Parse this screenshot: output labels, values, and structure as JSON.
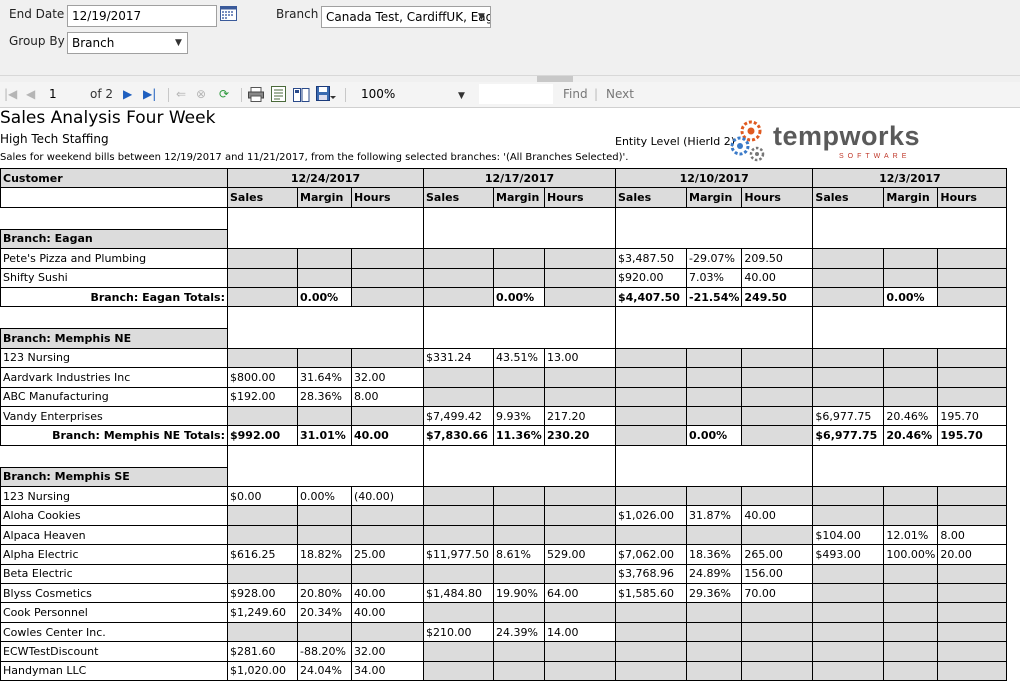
{
  "params": {
    "end_date_label": "End Date",
    "end_date_value": "12/19/2017",
    "branch_label": "Branch",
    "branch_value": "Canada Test, CardiffUK, Eag",
    "group_by_label": "Group By",
    "group_by_value": "Branch"
  },
  "toolbar": {
    "page_current": "1",
    "page_of": "of 2",
    "zoom": "100%",
    "search_value": "",
    "find_label": "Find",
    "sep": "|",
    "next_label": "Next"
  },
  "report": {
    "title": "Sales Analysis Four Week",
    "company": "High Tech Staffing",
    "description": "Sales for weekend bills between 12/19/2017 and 11/21/2017, from the following selected branches: '(All Branches Selected)'.",
    "entity_level": "Entity Level (HierId 2)",
    "logo_text": "tempworks",
    "logo_sub": "SOFTWARE",
    "customer_header": "Customer",
    "week_headers": [
      "12/24/2017",
      "12/17/2017",
      "12/10/2017",
      "12/3/2017"
    ],
    "col_sales": "Sales",
    "col_margin": "Margin",
    "col_hours": "Hours"
  },
  "rows": [
    {
      "type": "gap"
    },
    {
      "type": "branch",
      "label": "Branch: Eagan"
    },
    {
      "type": "data",
      "customer": "Pete's Pizza and Plumbing",
      "weeks": [
        [
          "",
          "",
          ""
        ],
        [
          "",
          "",
          ""
        ],
        [
          "$3,487.50",
          "-29.07%",
          "209.50"
        ],
        [
          "",
          "",
          ""
        ]
      ]
    },
    {
      "type": "data",
      "customer": "Shifty Sushi",
      "weeks": [
        [
          "",
          "",
          ""
        ],
        [
          "",
          "",
          ""
        ],
        [
          "$920.00",
          "7.03%",
          "40.00"
        ],
        [
          "",
          "",
          ""
        ]
      ]
    },
    {
      "type": "total",
      "label": "Branch: Eagan Totals:",
      "weeks": [
        [
          "",
          "0.00%",
          ""
        ],
        [
          "",
          "0.00%",
          ""
        ],
        [
          "$4,407.50",
          "-21.54%",
          "249.50"
        ],
        [
          "",
          "0.00%",
          ""
        ]
      ]
    },
    {
      "type": "gap"
    },
    {
      "type": "branch",
      "label": "Branch: Memphis NE"
    },
    {
      "type": "data",
      "customer": "123 Nursing",
      "weeks": [
        [
          "",
          "",
          ""
        ],
        [
          "$331.24",
          "43.51%",
          "13.00"
        ],
        [
          "",
          "",
          ""
        ],
        [
          "",
          "",
          ""
        ]
      ]
    },
    {
      "type": "data",
      "customer": "Aardvark Industries Inc",
      "weeks": [
        [
          "$800.00",
          "31.64%",
          "32.00"
        ],
        [
          "",
          "",
          ""
        ],
        [
          "",
          "",
          ""
        ],
        [
          "",
          "",
          ""
        ]
      ]
    },
    {
      "type": "data",
      "customer": "ABC Manufacturing",
      "weeks": [
        [
          "$192.00",
          "28.36%",
          "8.00"
        ],
        [
          "",
          "",
          ""
        ],
        [
          "",
          "",
          ""
        ],
        [
          "",
          "",
          ""
        ]
      ]
    },
    {
      "type": "data",
      "customer": "Vandy Enterprises",
      "weeks": [
        [
          "",
          "",
          ""
        ],
        [
          "$7,499.42",
          "9.93%",
          "217.20"
        ],
        [
          "",
          "",
          ""
        ],
        [
          "$6,977.75",
          "20.46%",
          "195.70"
        ]
      ]
    },
    {
      "type": "total",
      "label": "Branch: Memphis NE Totals:",
      "weeks": [
        [
          "$992.00",
          "31.01%",
          "40.00"
        ],
        [
          "$7,830.66",
          "11.36%",
          "230.20"
        ],
        [
          "",
          "0.00%",
          ""
        ],
        [
          "$6,977.75",
          "20.46%",
          "195.70"
        ]
      ]
    },
    {
      "type": "gap"
    },
    {
      "type": "branch",
      "label": "Branch: Memphis SE"
    },
    {
      "type": "data",
      "customer": "123 Nursing",
      "weeks": [
        [
          "$0.00",
          "0.00%",
          "(40.00)"
        ],
        [
          "",
          "",
          ""
        ],
        [
          "",
          "",
          ""
        ],
        [
          "",
          "",
          ""
        ]
      ]
    },
    {
      "type": "data",
      "customer": "Aloha Cookies",
      "weeks": [
        [
          "",
          "",
          ""
        ],
        [
          "",
          "",
          ""
        ],
        [
          "$1,026.00",
          "31.87%",
          "40.00"
        ],
        [
          "",
          "",
          ""
        ]
      ]
    },
    {
      "type": "data",
      "customer": "Alpaca Heaven",
      "weeks": [
        [
          "",
          "",
          ""
        ],
        [
          "",
          "",
          ""
        ],
        [
          "",
          "",
          ""
        ],
        [
          "$104.00",
          "12.01%",
          "8.00"
        ]
      ]
    },
    {
      "type": "data",
      "customer": "Alpha Electric",
      "weeks": [
        [
          "$616.25",
          "18.82%",
          "25.00"
        ],
        [
          "$11,977.50",
          "8.61%",
          "529.00"
        ],
        [
          "$7,062.00",
          "18.36%",
          "265.00"
        ],
        [
          "$493.00",
          "100.00%",
          "20.00"
        ]
      ]
    },
    {
      "type": "data",
      "customer": "Beta Electric",
      "weeks": [
        [
          "",
          "",
          ""
        ],
        [
          "",
          "",
          ""
        ],
        [
          "$3,768.96",
          "24.89%",
          "156.00"
        ],
        [
          "",
          "",
          ""
        ]
      ]
    },
    {
      "type": "data",
      "customer": "Blyss Cosmetics",
      "weeks": [
        [
          "$928.00",
          "20.80%",
          "40.00"
        ],
        [
          "$1,484.80",
          "19.90%",
          "64.00"
        ],
        [
          "$1,585.60",
          "29.36%",
          "70.00"
        ],
        [
          "",
          "",
          ""
        ]
      ]
    },
    {
      "type": "data",
      "customer": "Cook Personnel",
      "weeks": [
        [
          "$1,249.60",
          "20.34%",
          "40.00"
        ],
        [
          "",
          "",
          ""
        ],
        [
          "",
          "",
          ""
        ],
        [
          "",
          "",
          ""
        ]
      ]
    },
    {
      "type": "data",
      "customer": "Cowles Center Inc.",
      "weeks": [
        [
          "",
          "",
          ""
        ],
        [
          "$210.00",
          "24.39%",
          "14.00"
        ],
        [
          "",
          "",
          ""
        ],
        [
          "",
          "",
          ""
        ]
      ]
    },
    {
      "type": "data",
      "customer": "ECWTestDiscount",
      "weeks": [
        [
          "$281.60",
          "-88.20%",
          "32.00"
        ],
        [
          "",
          "",
          ""
        ],
        [
          "",
          "",
          ""
        ],
        [
          "",
          "",
          ""
        ]
      ]
    },
    {
      "type": "data",
      "customer": "Handyman LLC",
      "weeks": [
        [
          "$1,020.00",
          "24.04%",
          "34.00"
        ],
        [
          "",
          "",
          ""
        ],
        [
          "",
          "",
          ""
        ],
        [
          "",
          "",
          ""
        ]
      ]
    }
  ]
}
